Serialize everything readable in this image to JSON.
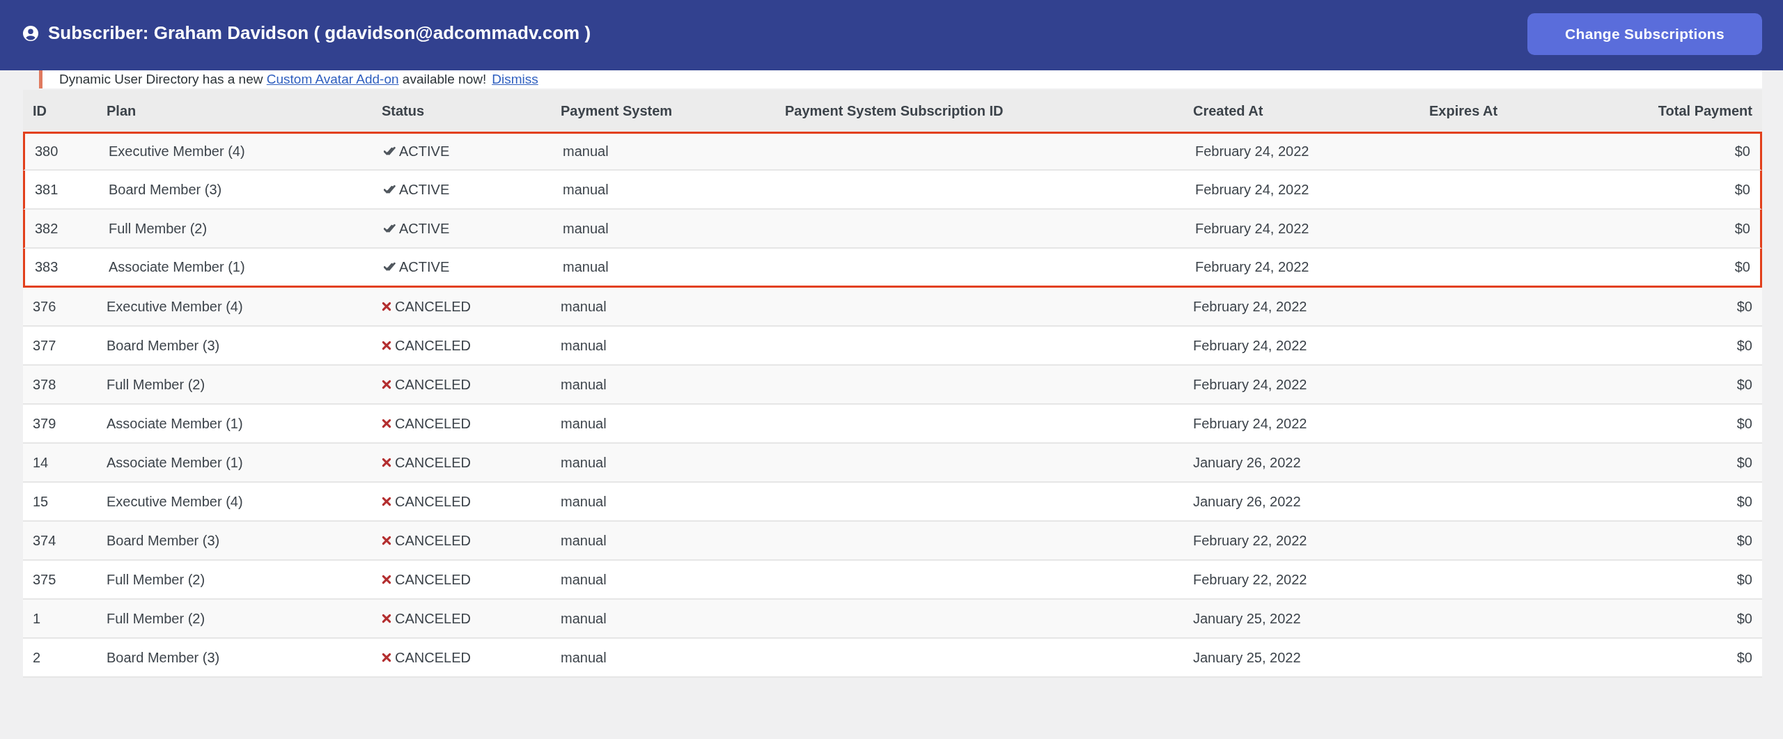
{
  "header": {
    "title": "Subscriber: Graham Davidson ( gdavidson@adcommadv.com )",
    "button": "Change Subscriptions"
  },
  "notice": {
    "before": "Dynamic User Directory has a new ",
    "link": "Custom Avatar Add-on",
    "after": " available now!",
    "dismiss": "Dismiss"
  },
  "table": {
    "columns": [
      "ID",
      "Plan",
      "Status",
      "Payment System",
      "Payment System Subscription ID",
      "Created At",
      "Expires At",
      "Total Payment"
    ],
    "rows": [
      {
        "id": "380",
        "plan": "Executive Member (4)",
        "status": {
          "kind": "active",
          "label": "ACTIVE"
        },
        "payment_system": "manual",
        "created": "February 24, 2022",
        "total": "$0",
        "highlighted": true
      },
      {
        "id": "381",
        "plan": "Board Member (3)",
        "status": {
          "kind": "active",
          "label": "ACTIVE"
        },
        "payment_system": "manual",
        "created": "February 24, 2022",
        "total": "$0",
        "highlighted": true
      },
      {
        "id": "382",
        "plan": "Full Member (2)",
        "status": {
          "kind": "active",
          "label": "ACTIVE"
        },
        "payment_system": "manual",
        "created": "February 24, 2022",
        "total": "$0",
        "highlighted": true
      },
      {
        "id": "383",
        "plan": "Associate Member (1)",
        "status": {
          "kind": "active",
          "label": "ACTIVE"
        },
        "payment_system": "manual",
        "created": "February 24, 2022",
        "total": "$0",
        "highlighted": true
      },
      {
        "id": "376",
        "plan": "Executive Member (4)",
        "status": {
          "kind": "canceled",
          "label": "CANCELED"
        },
        "payment_system": "manual",
        "created": "February 24, 2022",
        "total": "$0",
        "highlighted": false
      },
      {
        "id": "377",
        "plan": "Board Member (3)",
        "status": {
          "kind": "canceled",
          "label": "CANCELED"
        },
        "payment_system": "manual",
        "created": "February 24, 2022",
        "total": "$0",
        "highlighted": false
      },
      {
        "id": "378",
        "plan": "Full Member (2)",
        "status": {
          "kind": "canceled",
          "label": "CANCELED"
        },
        "payment_system": "manual",
        "created": "February 24, 2022",
        "total": "$0",
        "highlighted": false
      },
      {
        "id": "379",
        "plan": "Associate Member (1)",
        "status": {
          "kind": "canceled",
          "label": "CANCELED"
        },
        "payment_system": "manual",
        "created": "February 24, 2022",
        "total": "$0",
        "highlighted": false
      },
      {
        "id": "14",
        "plan": "Associate Member (1)",
        "status": {
          "kind": "canceled",
          "label": "CANCELED"
        },
        "payment_system": "manual",
        "created": "January 26, 2022",
        "total": "$0",
        "highlighted": false
      },
      {
        "id": "15",
        "plan": "Executive Member (4)",
        "status": {
          "kind": "canceled",
          "label": "CANCELED"
        },
        "payment_system": "manual",
        "created": "January 26, 2022",
        "total": "$0",
        "highlighted": false
      },
      {
        "id": "374",
        "plan": "Board Member (3)",
        "status": {
          "kind": "canceled",
          "label": "CANCELED"
        },
        "payment_system": "manual",
        "created": "February 22, 2022",
        "total": "$0",
        "highlighted": false
      },
      {
        "id": "375",
        "plan": "Full Member (2)",
        "status": {
          "kind": "canceled",
          "label": "CANCELED"
        },
        "payment_system": "manual",
        "created": "February 22, 2022",
        "total": "$0",
        "highlighted": false
      },
      {
        "id": "1",
        "plan": "Full Member (2)",
        "status": {
          "kind": "canceled",
          "label": "CANCELED"
        },
        "payment_system": "manual",
        "created": "January 25, 2022",
        "total": "$0",
        "highlighted": false
      },
      {
        "id": "2",
        "plan": "Board Member (3)",
        "status": {
          "kind": "canceled",
          "label": "CANCELED"
        },
        "payment_system": "manual",
        "created": "January 25, 2022",
        "total": "$0",
        "highlighted": false
      }
    ]
  }
}
